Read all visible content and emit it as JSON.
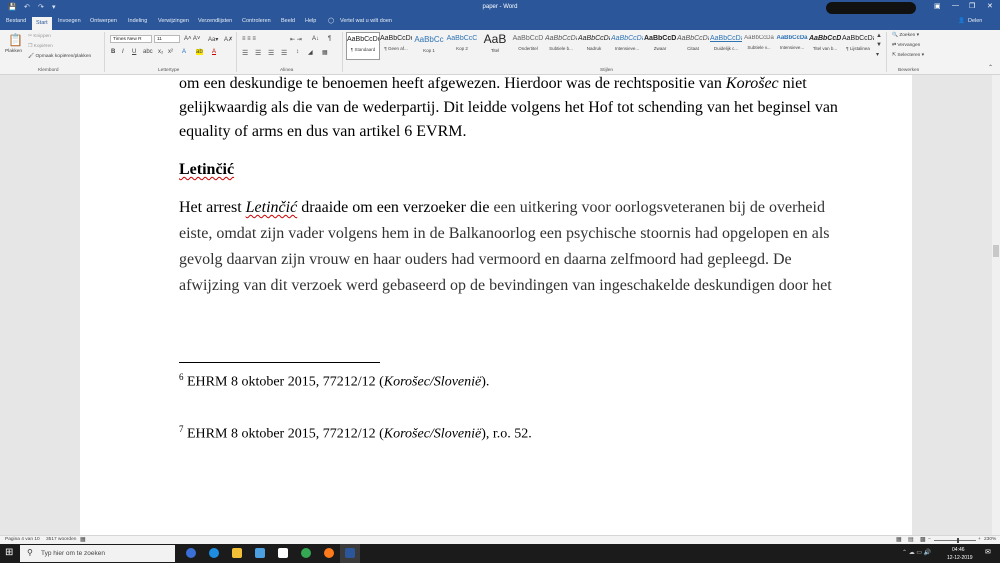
{
  "window": {
    "title": "paper - Word",
    "share_label": "Delen"
  },
  "tabs": [
    "Bestand",
    "Start",
    "Invoegen",
    "Ontwerpen",
    "Indeling",
    "Verwijzingen",
    "Verzendlijsten",
    "Controleren",
    "Beeld",
    "Help"
  ],
  "tell_me": "Vertel wat u wilt doen",
  "ribbon": {
    "clipboard": {
      "paste": "Plakken",
      "cut": "Knippen",
      "copy": "Kopiëren",
      "format_painter": "Opmaak kopiëren/plakken",
      "group": "Klembord"
    },
    "font": {
      "name": "Times New R",
      "size": "11",
      "group": "Lettertype"
    },
    "paragraph": {
      "group": "Alinea"
    },
    "styles": {
      "group": "Stijlen",
      "items": [
        {
          "sample": "AaBbCcDd",
          "name": "¶ Standaard"
        },
        {
          "sample": "AaBbCcDd",
          "name": "¶ Geen af..."
        },
        {
          "sample": "AaBbCc",
          "name": "Kop 1"
        },
        {
          "sample": "AaBbCcC",
          "name": "Kop 2"
        },
        {
          "sample": "AaB",
          "name": "Titel"
        },
        {
          "sample": "AaBbCcD",
          "name": "Ondertitel"
        },
        {
          "sample": "AaBbCcDa",
          "name": "Subtiele b..."
        },
        {
          "sample": "AaBbCcDa",
          "name": "Nadruk"
        },
        {
          "sample": "AaBbCcDa",
          "name": "Intensieve..."
        },
        {
          "sample": "AaBbCcDc",
          "name": "Zwaar"
        },
        {
          "sample": "AaBbCcDa",
          "name": "Citaat"
        },
        {
          "sample": "AaBbCcDa",
          "name": "Duidelijk c..."
        },
        {
          "sample": "AaBbCcDa",
          "name": "Subtiele v..."
        },
        {
          "sample": "AaBbCcDa",
          "name": "Intensieve..."
        },
        {
          "sample": "AaBbCcD",
          "name": "Titel van b..."
        },
        {
          "sample": "AaBbCcDa",
          "name": "¶ Lijstalinea"
        }
      ]
    },
    "editing": {
      "find": "Zoeken",
      "replace": "Vervangen",
      "select": "Selecteren",
      "group": "Bewerken"
    }
  },
  "document": {
    "p1_line1a": "om een deskundige te benoemen heeft afgewezen. Hierdoor was de rechtspositie van ",
    "p1_line1_italic": "Korošec",
    "p1_line1b": " niet",
    "p1_line2": "gelijkwaardig als die van de wederpartij. Dit leidde volgens het Hof tot schending van het beginsel van",
    "p1_line3": "equality of arms en dus van artikel 6 EVRM.",
    "heading": "Letinčić",
    "p2_line1a": "Het arrest ",
    "p2_line1_italic": "Letinčić",
    "p2_line1b": " draaide om een verzoeker die ",
    "p2_line1c": "een uitkering voor oorlogsveteranen bij de overheid",
    "p2_line2": "eiste, omdat zijn vader volgens hem in de Balkanoorlog een psychische stoornis had opgelopen en als",
    "p2_line3": "gevolg daarvan zijn vrouw en haar ouders had vermoord en daarna zelfmoord had gepleegd. De",
    "p2_line4": "afwijzing van dit verzoek werd gebaseerd op de bevindingen van ingeschakelde deskundigen door het",
    "footnotes": [
      {
        "num": "6",
        "text_a": " EHRM 8 oktober 2015, 77212/12 (",
        "italic": "Korošec/Slovenië",
        "text_b": ")."
      },
      {
        "num": "7",
        "text_a": " EHRM 8 oktober 2015, 77212/12 (",
        "italic": "Korošec/Slovenië",
        "text_b": "), r.o. 52."
      }
    ]
  },
  "status": {
    "page": "Pagina 4 van 10",
    "words": "3517 woorden",
    "zoom": "230%"
  },
  "taskbar": {
    "search_placeholder": "Typ hier om te zoeken",
    "time": "04:46",
    "date": "12-12-2019"
  }
}
